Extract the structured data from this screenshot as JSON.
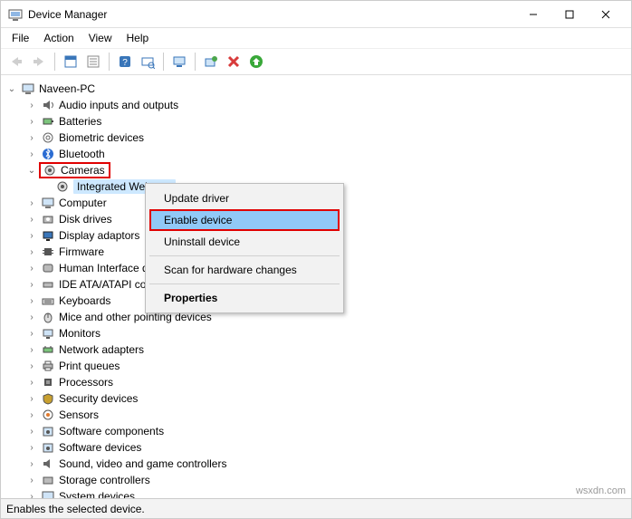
{
  "window": {
    "title": "Device Manager"
  },
  "menu": {
    "file": "File",
    "action": "Action",
    "view": "View",
    "help": "Help"
  },
  "tree": {
    "root": "Naveen-PC",
    "items": [
      {
        "label": "Audio inputs and outputs"
      },
      {
        "label": "Batteries"
      },
      {
        "label": "Biometric devices"
      },
      {
        "label": "Bluetooth"
      },
      {
        "label": "Cameras"
      },
      {
        "label": "Integrated Webcam"
      },
      {
        "label": "Computer"
      },
      {
        "label": "Disk drives"
      },
      {
        "label": "Display adaptors"
      },
      {
        "label": "Firmware"
      },
      {
        "label": "Human Interface devices"
      },
      {
        "label": "IDE ATA/ATAPI controllers"
      },
      {
        "label": "Keyboards"
      },
      {
        "label": "Mice and other pointing devices"
      },
      {
        "label": "Monitors"
      },
      {
        "label": "Network adapters"
      },
      {
        "label": "Print queues"
      },
      {
        "label": "Processors"
      },
      {
        "label": "Security devices"
      },
      {
        "label": "Sensors"
      },
      {
        "label": "Software components"
      },
      {
        "label": "Software devices"
      },
      {
        "label": "Sound, video and game controllers"
      },
      {
        "label": "Storage controllers"
      },
      {
        "label": "System devices"
      }
    ]
  },
  "context": {
    "update": "Update driver",
    "enable": "Enable device",
    "uninstall": "Uninstall device",
    "scan": "Scan for hardware changes",
    "properties": "Properties"
  },
  "status": {
    "text": "Enables the selected device."
  },
  "watermark": "wsxdn.com"
}
